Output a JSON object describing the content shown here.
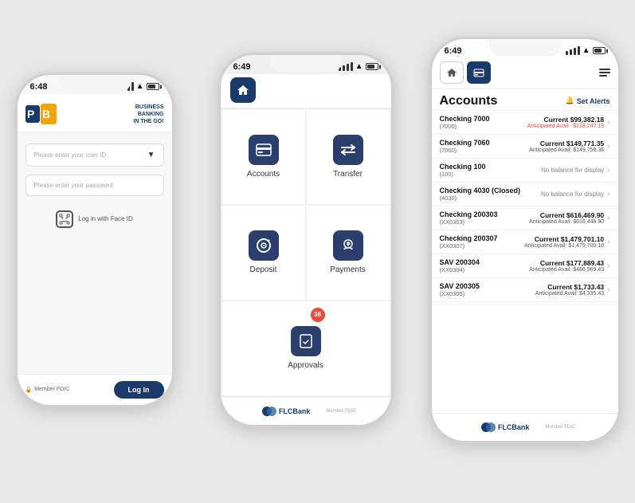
{
  "phones": {
    "phone1": {
      "time": "6:48",
      "logo_text_right": [
        "BUSINESS",
        "BANKING",
        "IN THE GO!"
      ],
      "user_id_placeholder": "Please enter your user ID",
      "password_placeholder": "Please enter your password",
      "face_id_label": "Log in with Face ID",
      "login_button": "Log In",
      "fdic_label": "Member FDIC"
    },
    "phone2": {
      "time": "6:49",
      "menu_items": [
        {
          "label": "Accounts",
          "icon": "$"
        },
        {
          "label": "Transfer",
          "icon": "⇄"
        },
        {
          "label": "Deposit",
          "icon": "📷"
        },
        {
          "label": "Payments",
          "icon": "💲"
        },
        {
          "label": "Approvals",
          "icon": "✓",
          "badge": "38"
        }
      ],
      "bank_name": "FLCBank"
    },
    "phone3": {
      "time": "6:49",
      "title": "Accounts",
      "set_alerts": "Set Alerts",
      "accounts": [
        {
          "name": "Checking 7000",
          "num": "(7000)",
          "current": "Current $99,382.18",
          "avail": "Anticipated Avail: -$218,247.13",
          "avail_negative": true
        },
        {
          "name": "Checking 7060",
          "num": "(7060)",
          "current": "Current $149,771.35",
          "avail": "Anticipated Avail: $149,758.36",
          "avail_negative": false
        },
        {
          "name": "Checking 100",
          "num": "(100)",
          "current": "",
          "avail": "No balance for display",
          "avail_negative": false,
          "no_balance": true
        },
        {
          "name": "Checking 4030 (Closed)",
          "num": "(4030)",
          "current": "",
          "avail": "No balance for display",
          "avail_negative": false,
          "no_balance": true
        },
        {
          "name": "Checking 200303",
          "num": "(XX0303)",
          "current": "Current $616,469.90",
          "avail": "Anticipated Avail: $616,448.90",
          "avail_negative": false
        },
        {
          "name": "Checking 200307",
          "num": "(XX0307)",
          "current": "Current $1,479,701.10",
          "avail": "Anticipated Avail: $1,479,700.10",
          "avail_negative": false
        },
        {
          "name": "SAV 200304",
          "num": "(XX0304)",
          "current": "Current $177,889.43",
          "avail": "Anticipated Avail: $486,969.43",
          "avail_negative": false
        },
        {
          "name": "SAV 200305",
          "num": "(XX0305)",
          "current": "Current $1,733.43",
          "avail": "Anticipated Avail: $4,335.43",
          "avail_negative": false
        }
      ],
      "bank_name": "FLCBank"
    }
  }
}
